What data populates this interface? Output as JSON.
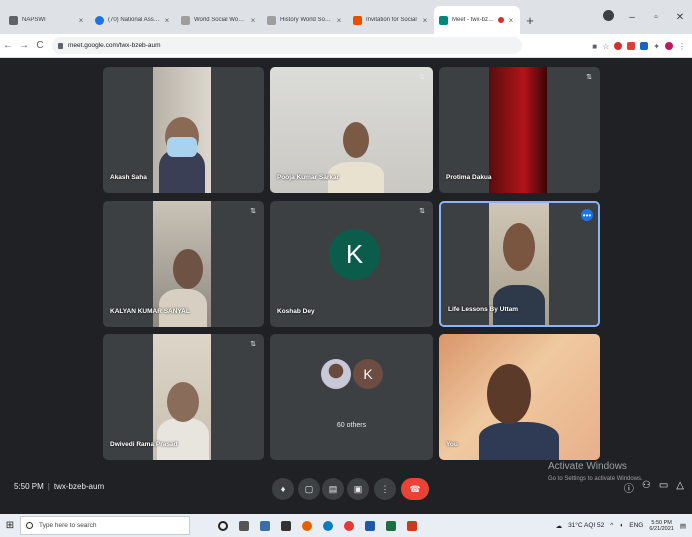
{
  "browser": {
    "tabs": [
      {
        "title": "NAPSWI",
        "active": false,
        "favicon_color": "#5f6368"
      },
      {
        "title": "(70) National Associa",
        "active": false,
        "favicon_color": "#1a73e8"
      },
      {
        "title": "World Social Work Da",
        "active": false,
        "favicon_color": "#9e9e9e"
      },
      {
        "title": "History World Social",
        "active": false,
        "favicon_color": "#9e9e9e"
      },
      {
        "title": "Invitation for Social",
        "active": false,
        "favicon_color": "#e65100"
      },
      {
        "title": "Meet - twx-bzeb-",
        "active": true,
        "favicon_color": "#00897b"
      }
    ],
    "new_tab": "+",
    "url": "meet.google.com/twx-bzeb-aum",
    "window_controls": {
      "minimize": "–",
      "maximize": "▫",
      "close": "✕"
    }
  },
  "participants": [
    {
      "name": "Akash Saha",
      "mask": true
    },
    {
      "name": "Pooja Kumar Sarkar"
    },
    {
      "name": "Protima Dakua"
    },
    {
      "name": "KALYAN KUMAR SANYAL"
    },
    {
      "name": "Koshab Dey",
      "avatar_letter": "K"
    },
    {
      "name": "Life Lessons By Uttam",
      "highlighted": true
    },
    {
      "name": "Dwivedi Rama Prasad"
    },
    {
      "name": "60 others",
      "mini_letter": "K"
    },
    {
      "name": "You"
    }
  ],
  "meetbar": {
    "time": "5:50 PM",
    "meeting_code": "twx-bzeb-aum",
    "activate_title": "Activate Windows",
    "activate_sub": "Go to Settings to activate Windows."
  },
  "taskbar": {
    "search_placeholder": "Type here to search",
    "weather": "31°C AQI 52",
    "lang": "ENG",
    "clock_time": "5:50 PM",
    "clock_date": "6/21/2021"
  },
  "colors": {
    "meet_bg": "#202124",
    "tile_bg": "#3c4043",
    "end_call": "#ea4335",
    "active_border": "#8ab4f8",
    "avatar_green": "#0b5c4b"
  }
}
